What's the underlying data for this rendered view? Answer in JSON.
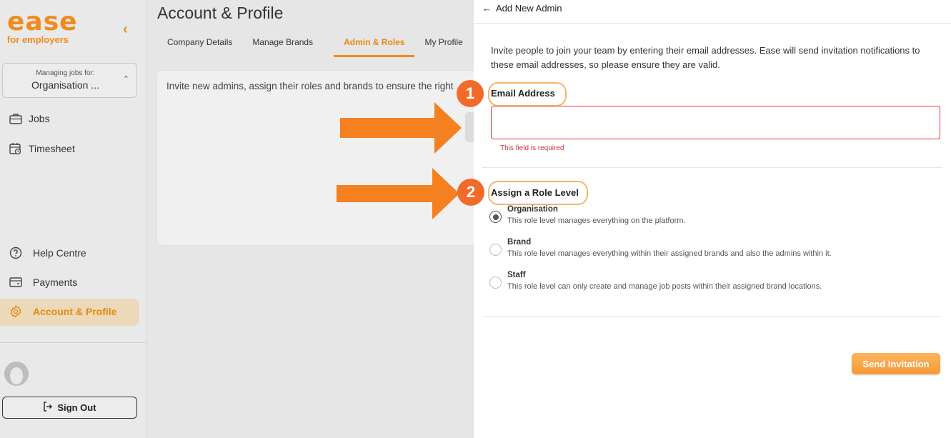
{
  "sidebar": {
    "logo": "ease",
    "logo_sub": "for employers",
    "managing_label": "Managing jobs for:",
    "managing_value": "Organisation ...",
    "nav": {
      "jobs": "Jobs",
      "timesheet": "Timesheet",
      "help": "Help Centre",
      "payments": "Payments",
      "account": "Account & Profile"
    },
    "sign_out": "Sign Out"
  },
  "main": {
    "title": "Account & Profile",
    "tabs": [
      "Company Details",
      "Manage Brands",
      "Admin & Roles",
      "My Profile"
    ],
    "active_tab": "Admin & Roles",
    "card_text": "Invite new admins, assign their roles and brands to ensure the right"
  },
  "drawer": {
    "back_label": "Add New Admin",
    "intro": "Invite people to join your team by entering their email addresses. Ease will send invitation notifications to these email addresses, so please ensure they are valid.",
    "email_label": "Email Address",
    "email_value": "",
    "email_error": "This field is required",
    "role_label": "Assign a Role Level",
    "roles": [
      {
        "title": "Organisation",
        "desc": "This role level manages everything on the platform.",
        "checked": true
      },
      {
        "title": "Brand",
        "desc": "This role level manages everything within their assigned brands and also the admins within it.",
        "checked": false
      },
      {
        "title": "Staff",
        "desc": "This role level can only create and manage job posts within their assigned brand locations.",
        "checked": false
      }
    ],
    "send_button": "Send Invitation"
  },
  "annotations": {
    "step1": "1",
    "step2": "2",
    "accent_color": "#f26a2a"
  }
}
